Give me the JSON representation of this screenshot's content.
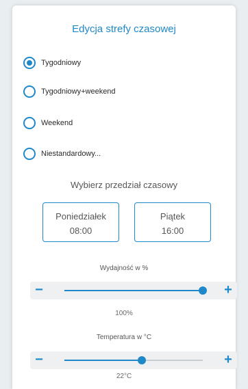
{
  "header": {
    "title": "Edycja strefy czasowej"
  },
  "schedule_options": [
    {
      "label": "Tygodniowy",
      "selected": true
    },
    {
      "label": "Tygodniowy+weekend",
      "selected": false
    },
    {
      "label": "Weekend",
      "selected": false
    },
    {
      "label": "Niestandardowy...",
      "selected": false
    }
  ],
  "range": {
    "title": "Wybierz przedział czasowy",
    "start": {
      "day": "Poniedziałek",
      "time": "08:00"
    },
    "end": {
      "day": "Piątek",
      "time": "16:00"
    }
  },
  "efficiency": {
    "label": "Wydajność w %",
    "value_text": "100%",
    "level": 1.0
  },
  "temperature": {
    "label": "Temperatura w °C",
    "value_text": "22°C",
    "level": 0.56
  },
  "controls": {
    "minus": "−",
    "plus": "+"
  },
  "colors": {
    "accent": "#1f88c8"
  }
}
